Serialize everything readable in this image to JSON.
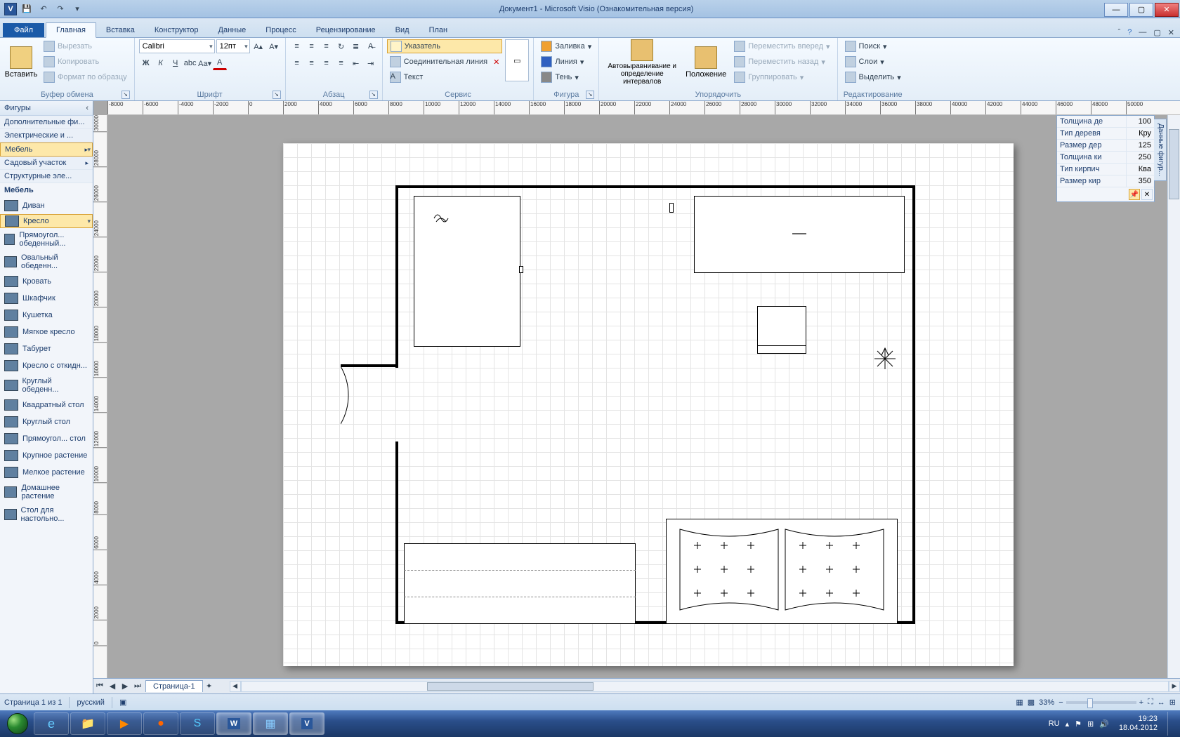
{
  "title": "Документ1 - Microsoft Visio (Ознакомительная версия)",
  "ribbon": {
    "file": "Файл",
    "tabs": [
      "Главная",
      "Вставка",
      "Конструктор",
      "Данные",
      "Процесс",
      "Рецензирование",
      "Вид",
      "План"
    ],
    "active_tab": "Главная",
    "groups": {
      "clipboard": {
        "label": "Буфер обмена",
        "paste": "Вставить",
        "cut": "Вырезать",
        "copy": "Копировать",
        "format": "Формат по образцу"
      },
      "font": {
        "label": "Шрифт",
        "name": "Calibri",
        "size": "12пт"
      },
      "para": {
        "label": "Абзац"
      },
      "service": {
        "label": "Сервис",
        "pointer": "Указатель",
        "connector": "Соединительная линия",
        "text": "Текст"
      },
      "figure": {
        "label": "Фигура",
        "fill": "Заливка",
        "line": "Линия",
        "shadow": "Тень"
      },
      "arrange": {
        "label": "Упорядочить",
        "auto": "Автовыравнивание и определение интервалов",
        "position": "Положение",
        "front": "Переместить вперед",
        "back": "Переместить назад",
        "group": "Группировать"
      },
      "edit": {
        "label": "Редактирование",
        "find": "Поиск",
        "layers": "Слои",
        "select": "Выделить"
      }
    }
  },
  "shapes_panel": {
    "title": "Фигуры",
    "categories": [
      "Дополнительные фи...",
      "Электрические и ...",
      "Мебель",
      "Садовый участок",
      "Структурные эле..."
    ],
    "selected_category": "Мебель",
    "group_title": "Мебель",
    "items": [
      "Диван",
      "Кресло",
      "Прямоугол... обеденный...",
      "Овальный обеденн...",
      "Кровать",
      "Шкафчик",
      "Кушетка",
      "Мягкое кресло",
      "Табурет",
      "Кресло с откидн...",
      "Круглый обеденн...",
      "Квадратный стол",
      "Круглый стол",
      "Прямоугол... стол",
      "Крупное растение",
      "Мелкое растение",
      "Домашнее растение",
      "Стол для настольно..."
    ],
    "selected_item": "Кресло"
  },
  "shape_data": {
    "tab": "Данные фигур...",
    "rows": [
      {
        "k": "Толщина де",
        "v": "100"
      },
      {
        "k": "Тип деревя",
        "v": "Кру"
      },
      {
        "k": "Размер дер",
        "v": "125"
      },
      {
        "k": "Толщина ки",
        "v": "250"
      },
      {
        "k": "Тип кирпич",
        "v": "Ква"
      },
      {
        "k": "Размер кир",
        "v": "350"
      }
    ]
  },
  "page_tabs": {
    "page": "Страница-1"
  },
  "status": {
    "page": "Страница 1 из 1",
    "lang": "русский",
    "zoom": "33%"
  },
  "ruler_h": [
    "-8000",
    "-6000",
    "-4000",
    "-2000",
    "0",
    "2000",
    "4000",
    "6000",
    "8000",
    "10000",
    "12000",
    "14000",
    "16000",
    "18000",
    "20000",
    "22000",
    "24000",
    "26000",
    "28000",
    "30000",
    "32000",
    "34000",
    "36000",
    "38000",
    "40000",
    "42000",
    "44000",
    "46000",
    "48000",
    "50000"
  ],
  "ruler_v": [
    "30000",
    "28000",
    "26000",
    "24000",
    "22000",
    "20000",
    "18000",
    "16000",
    "14000",
    "12000",
    "10000",
    "8000",
    "6000",
    "4000",
    "2000",
    "0"
  ],
  "taskbar": {
    "lang": "RU",
    "time": "19:23",
    "date": "18.04.2012"
  }
}
